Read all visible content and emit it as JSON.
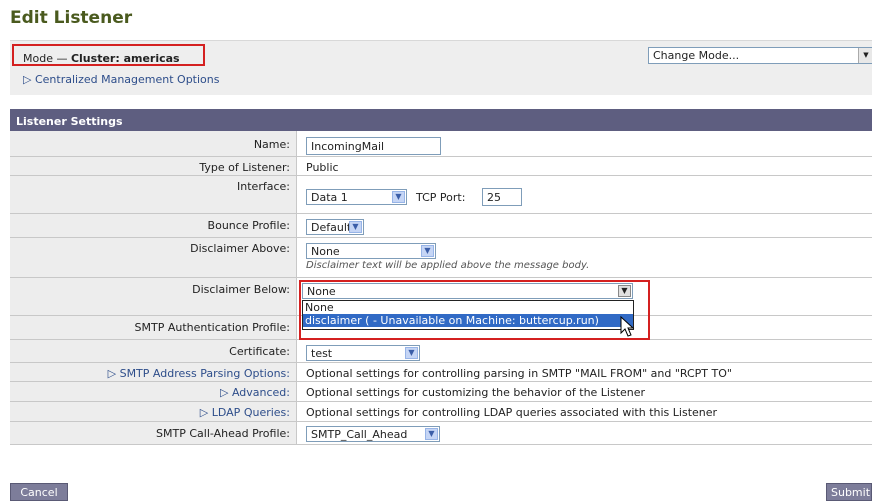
{
  "page": {
    "title": "Edit Listener"
  },
  "mode": {
    "prefix": "Mode —",
    "cluster": "Cluster: americas",
    "central_link": "▷ Centralized Management Options",
    "change_mode": "Change Mode..."
  },
  "panel": {
    "heading": "Listener Settings",
    "name_label": "Name:",
    "name_value": "IncomingMail",
    "type_label": "Type of Listener:",
    "type_value": "Public",
    "interface_label": "Interface:",
    "interface_value": "Data 1",
    "tcp_label": "TCP Port:",
    "tcp_value": "25",
    "bounce_label": "Bounce Profile:",
    "bounce_value": "Default",
    "disc_above_label": "Disclaimer Above:",
    "disc_above_value": "None",
    "disc_above_help": "Disclaimer text will be applied above the message body.",
    "disc_below_label": "Disclaimer Below:",
    "disc_below_value": "None",
    "disc_below_options": [
      "None",
      "disclaimer ( - Unavailable on Machine: buttercup.run)"
    ],
    "smtp_auth_label": "SMTP Authentication Profile:",
    "cert_label": "Certificate:",
    "cert_value": "test",
    "parsing_label": "▷ SMTP Address Parsing Options:",
    "parsing_text": "Optional settings for controlling parsing in SMTP \"MAIL FROM\" and \"RCPT TO\"",
    "advanced_label": "▷ Advanced:",
    "advanced_text": "Optional settings for customizing the behavior of the Listener",
    "ldap_label": "▷ LDAP Queries:",
    "ldap_text": "Optional settings for controlling LDAP queries associated with this Listener",
    "callahead_label": "SMTP Call-Ahead Profile:",
    "callahead_value": "SMTP_Call_Ahead"
  },
  "buttons": {
    "cancel": "Cancel",
    "submit": "Submit"
  },
  "colors": {
    "title": "#4a5a1e",
    "header": "#5e5e80",
    "highlight": "#d42020",
    "selection": "#316ac5"
  }
}
